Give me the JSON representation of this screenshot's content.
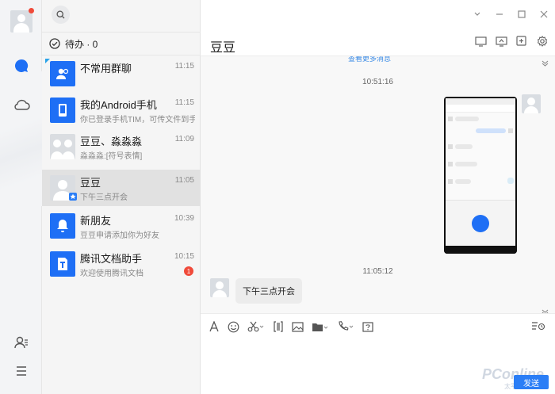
{
  "todo": {
    "label": "待办 · 0"
  },
  "sessions": [
    {
      "name": "不常用群聊",
      "sub": "",
      "time": "11:15"
    },
    {
      "name": "我的Android手机",
      "sub": "你已登录手机TIM，可传文件到手机",
      "time": "11:15"
    },
    {
      "name": "豆豆、淼淼淼",
      "sub": "淼淼淼:[符号表情]",
      "time": "11:09"
    },
    {
      "name": "豆豆",
      "sub": "下午三点开会",
      "time": "11:05"
    },
    {
      "name": "新朋友",
      "sub": "豆豆申请添加你为好友",
      "time": "10:39"
    },
    {
      "name": "腾讯文档助手",
      "sub": "欢迎使用腾讯文档",
      "time": "10:15",
      "badge": "1"
    }
  ],
  "chat": {
    "title": "豆豆",
    "older_hint": "查看更多消息",
    "timestamps": [
      "10:51:16",
      "11:05:12"
    ],
    "message_text": "下午三点开会",
    "send_label": "发送"
  },
  "watermark": {
    "brand": "PConline",
    "site": "太平洋电脑网"
  },
  "colors": {
    "accent": "#1e6ff5",
    "badge": "#f04a3a"
  }
}
